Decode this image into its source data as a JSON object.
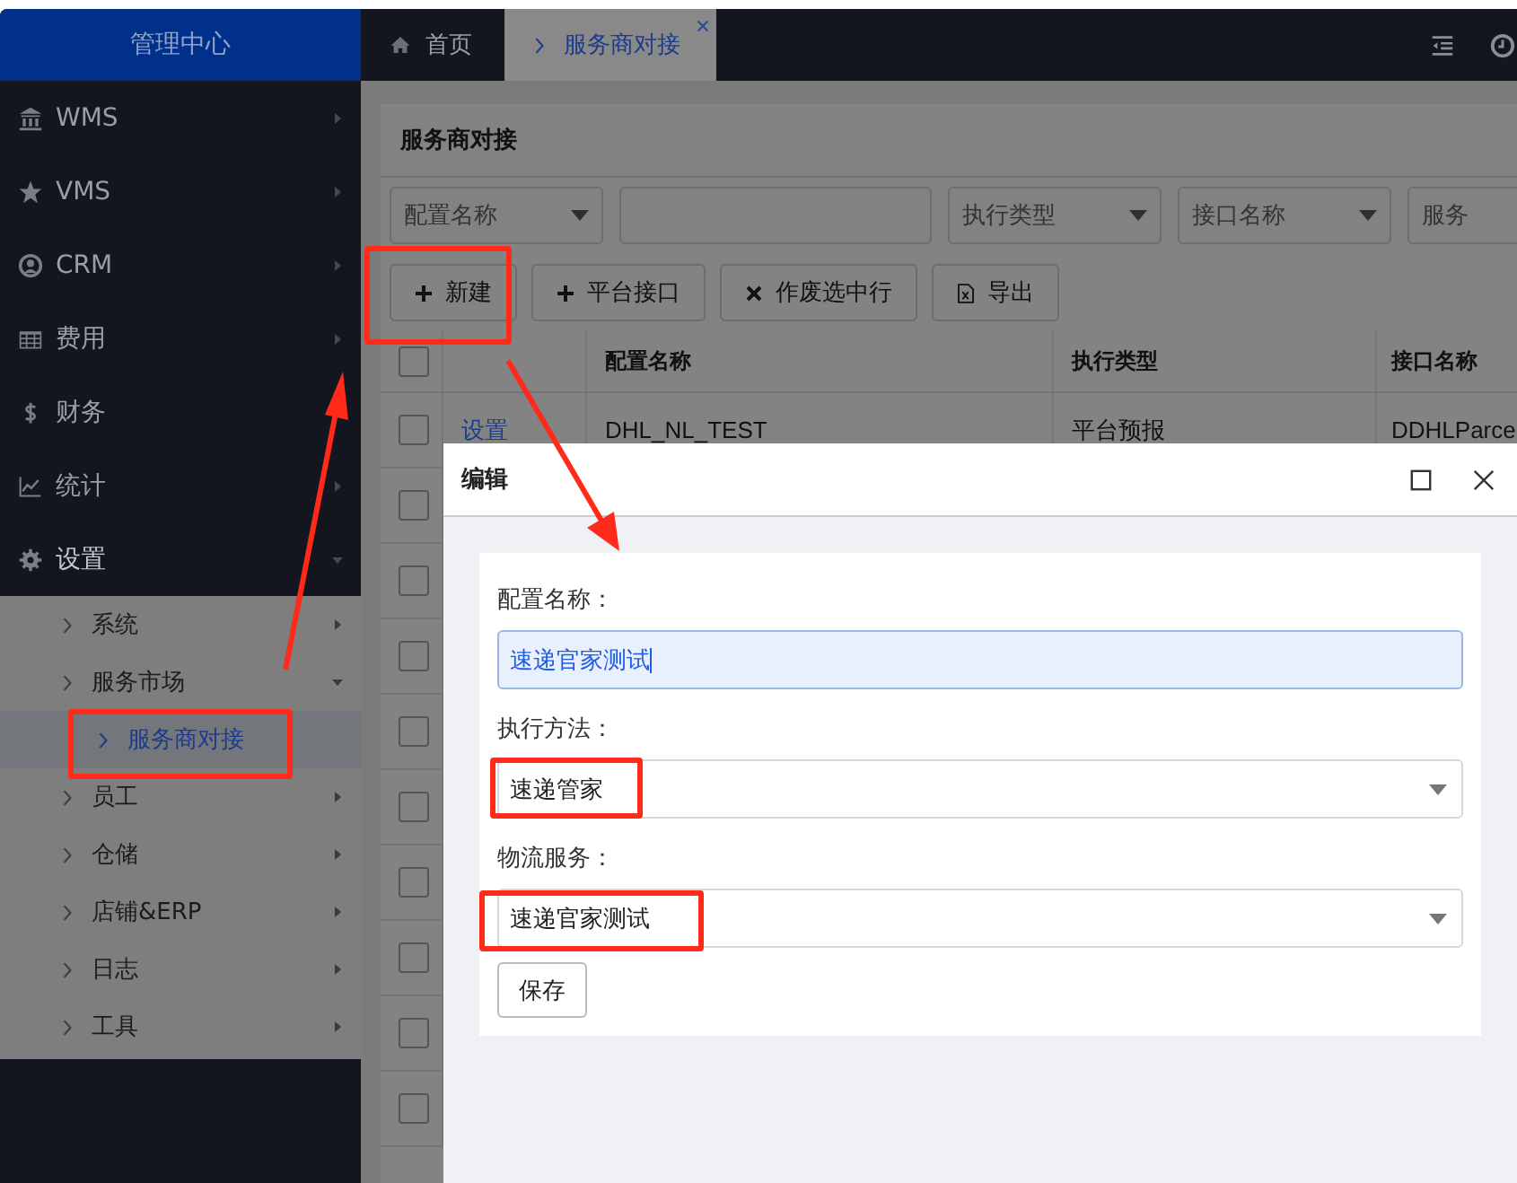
{
  "sidebar": {
    "title": "管理中心",
    "menu": [
      {
        "label": "WMS",
        "kind": "bank",
        "expanded": false
      },
      {
        "label": "VMS",
        "kind": "star",
        "expanded": false
      },
      {
        "label": "CRM",
        "kind": "user",
        "expanded": false
      },
      {
        "label": "费用",
        "kind": "grid",
        "expanded": false
      },
      {
        "label": "财务",
        "kind": "dollar"
      },
      {
        "label": "统计",
        "kind": "chart",
        "expanded": false
      },
      {
        "label": "设置",
        "kind": "gear",
        "expanded": true,
        "children": [
          {
            "label": "系统",
            "expanded": false,
            "selected": false
          },
          {
            "label": "服务市场",
            "expanded": true,
            "selected": false,
            "children": [
              {
                "label": "服务商对接",
                "selected": true
              }
            ]
          },
          {
            "label": "员工",
            "expanded": false,
            "selected": false
          },
          {
            "label": "仓储",
            "expanded": false,
            "selected": false
          },
          {
            "label": "店铺&ERP",
            "expanded": false,
            "selected": false
          },
          {
            "label": "日志",
            "expanded": false,
            "selected": false
          },
          {
            "label": "工具",
            "expanded": false,
            "selected": false
          }
        ]
      }
    ]
  },
  "tabs": [
    {
      "label": "首页",
      "kind": "home",
      "selected": false,
      "closable": false
    },
    {
      "label": "服务商对接",
      "kind": "page",
      "selected": true,
      "closable": true
    }
  ],
  "panel": {
    "title": "服务商对接",
    "filters": [
      {
        "kind": "select",
        "placeholder": "配置名称"
      },
      {
        "kind": "input"
      },
      {
        "kind": "select",
        "placeholder": "执行类型"
      },
      {
        "kind": "select",
        "placeholder": "接口名称"
      },
      {
        "kind": "cut",
        "placeholder": "服务"
      }
    ],
    "toolbar": [
      {
        "label": "新建",
        "kind": "plus"
      },
      {
        "label": "平台接口",
        "kind": "plus"
      },
      {
        "label": "作废选中行",
        "kind": "cross"
      },
      {
        "label": "导出",
        "kind": "excel"
      }
    ],
    "table": {
      "select_all": {
        "checked": false
      },
      "columns": [
        {
          "label": "配置名称"
        },
        {
          "label": "执行类型"
        },
        {
          "label": "接口名称"
        }
      ],
      "rows": [
        {
          "checked": false,
          "action": "设置",
          "cells": [
            "DHL_NL_TEST",
            "平台预报",
            "DDHLParce"
          ]
        },
        {
          "checked": false
        },
        {
          "checked": false
        },
        {
          "checked": false
        },
        {
          "checked": false
        },
        {
          "checked": false
        },
        {
          "checked": false
        },
        {
          "checked": false
        },
        {
          "checked": false
        },
        {
          "checked": false
        }
      ]
    }
  },
  "dialog": {
    "title": "编辑",
    "fields": [
      {
        "label": "配置名称：",
        "kind": "input",
        "value": "速递官家测试",
        "focused": true
      },
      {
        "label": "执行方法：",
        "kind": "select",
        "value": "速递管家",
        "focused": false
      },
      {
        "label": "物流服务：",
        "kind": "select",
        "value": "速递官家测试",
        "focused": false
      }
    ],
    "button": "保存"
  }
}
